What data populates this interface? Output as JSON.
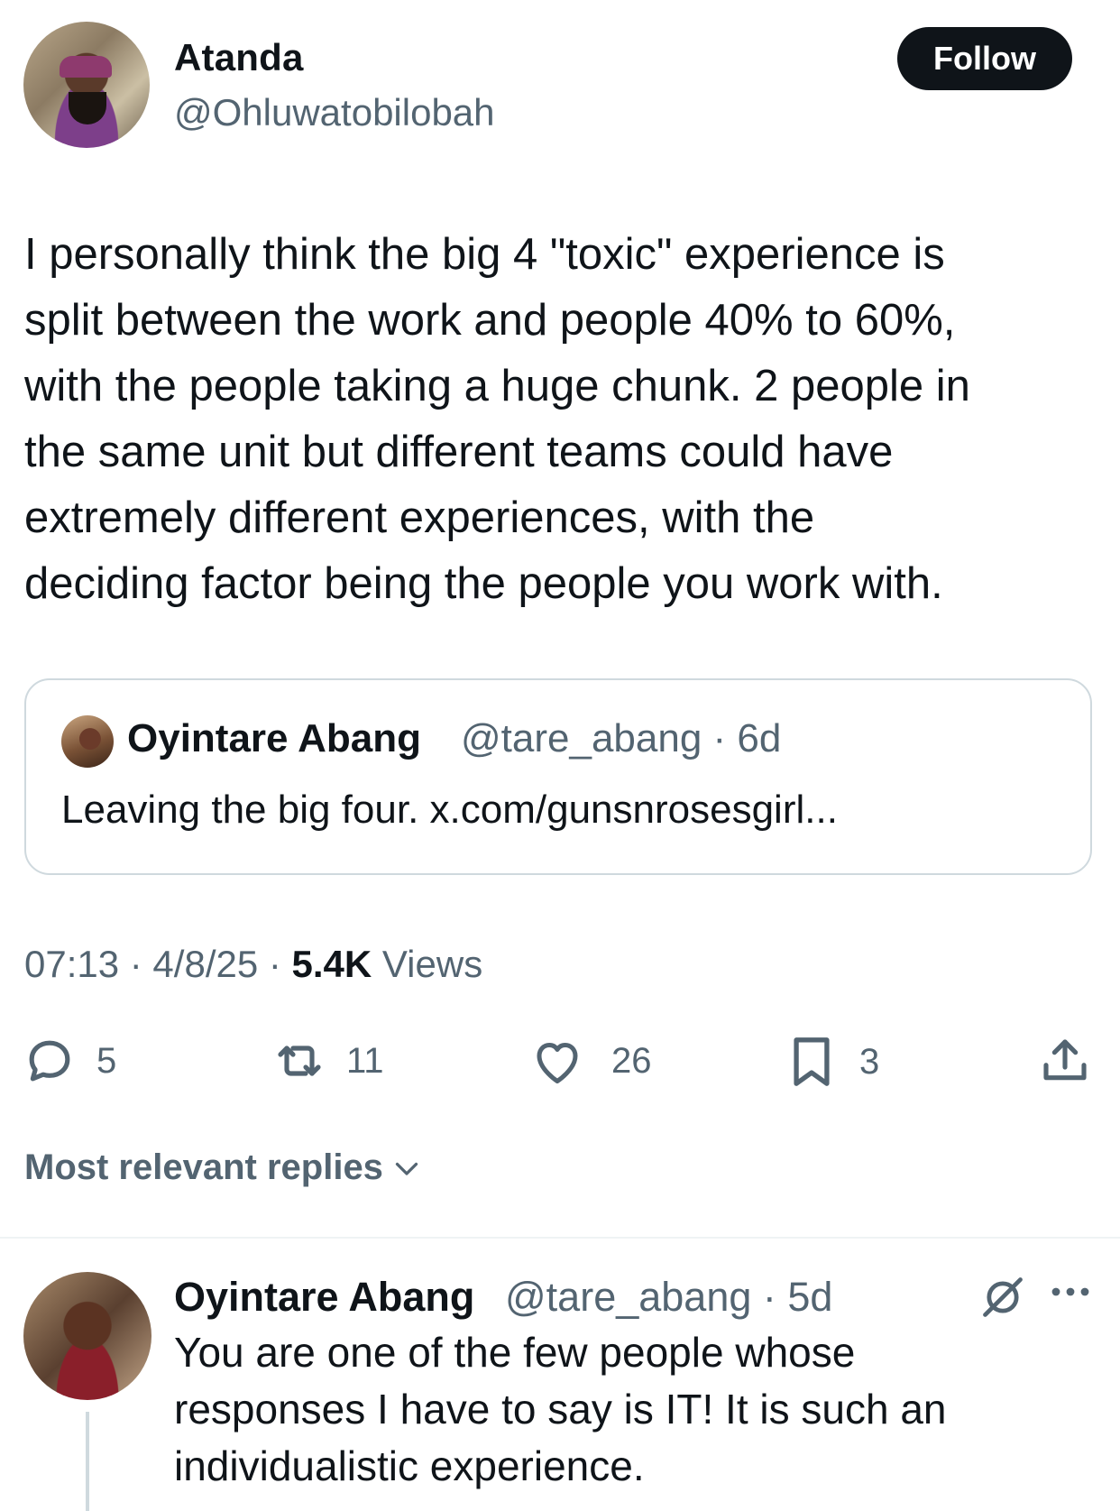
{
  "tweet": {
    "author_name": "Atanda",
    "author_handle": "@Ohluwatobilobah",
    "follow_label": "Follow",
    "text": "I personally think the big 4 \"toxic\" experience is\nsplit between the work and people 40% to 60%,\nwith the people taking a huge chunk. 2 people in\nthe same unit but different teams could have\nextremely different experiences, with the\ndeciding factor being the people you work with.",
    "quote": {
      "author_name": "Oyintare Abang",
      "author_handle_time": "@tare_abang · 6d",
      "text": "Leaving the big four. x.com/gunsnrosesgirl..."
    },
    "time": "07:13 · 4/8/25 · ",
    "views_count": "5.4K",
    "views_label": " Views",
    "stats": {
      "replies": "5",
      "retweets": "11",
      "likes": "26",
      "bookmarks": "3"
    }
  },
  "replies_section": {
    "sort_label": "Most relevant replies"
  },
  "reply": {
    "author_name": "Oyintare Abang",
    "author_handle_time": "@tare_abang · 5d",
    "text": "You are one of the few people whose\nresponses I have to say is IT! It is such an\nindividualistic experience."
  }
}
